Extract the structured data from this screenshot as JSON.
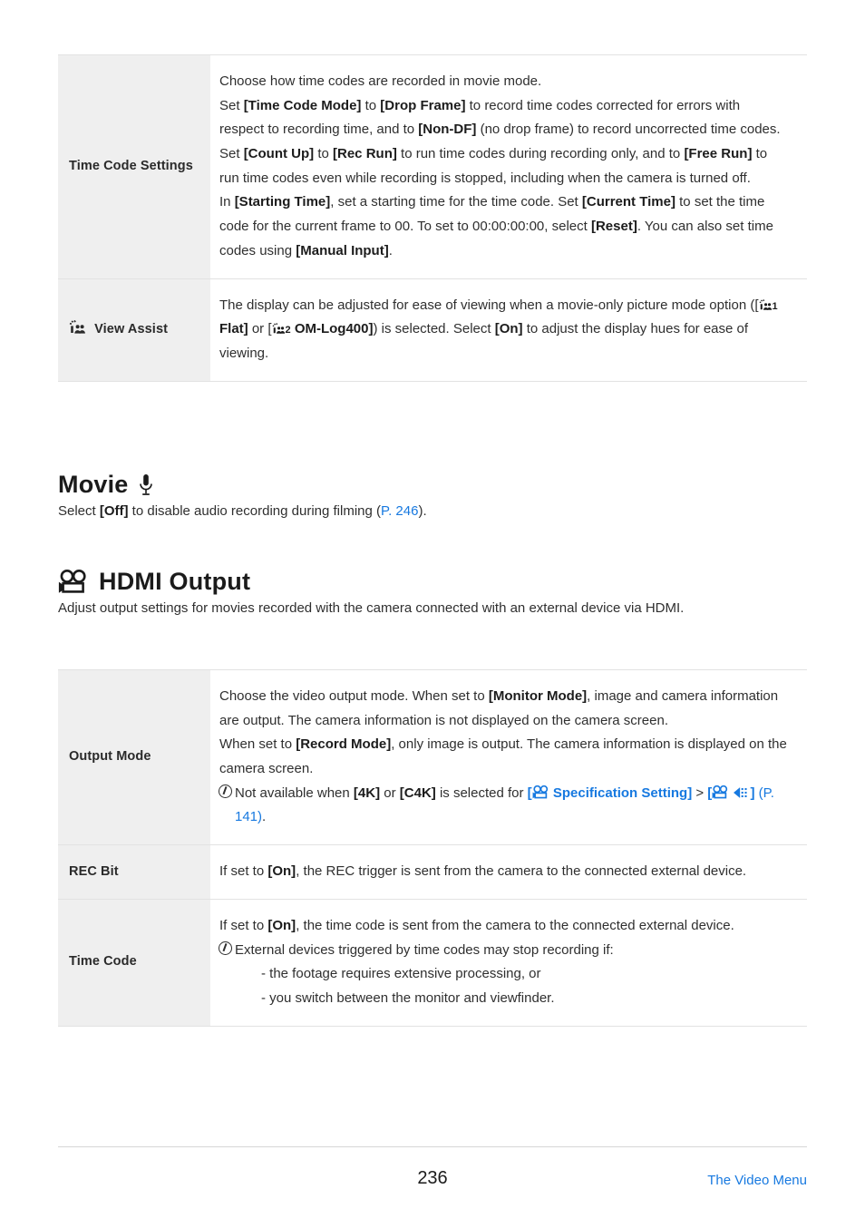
{
  "page": {
    "number": "236",
    "footer_link": "The Video Menu"
  },
  "table_timecode": {
    "rows": [
      {
        "label": "Time Code Settings",
        "label_icon": null,
        "paragraphs": [
          "Choose how time codes are recorded in movie mode.",
          "Set [Time Code Mode] to [Drop Frame] to record time codes corrected for errors with respect to recording time, and to [Non-DF] (no drop frame) to record uncorrected time codes.",
          "Set [Count Up] to [Rec Run] to run time codes during recording only, and to [Free Run] to run time codes even while recording is stopped, including when the camera is turned off.",
          "In [Starting Time], set a starting time for the time code. Set [Current Time] to set the time code for the current frame to 00. To set to 00:00:00:00, select [Reset]. You can also set time codes using [Manual Input]."
        ]
      },
      {
        "label": "View Assist",
        "label_icon": "picture-mode-movie-icon",
        "paragraphs": [
          "The display can be adjusted for ease of viewing when a movie-only picture mode option ([☀₁ Flat] or [☀₂ OM-Log400]) is selected. Select [On] to adjust the display hues for ease of viewing."
        ]
      }
    ]
  },
  "heading_movie": {
    "title": "Movie",
    "icon": "microphone-icon",
    "description_before": "Select ",
    "description_bold": "[Off]",
    "description_after": " to disable audio recording during filming (",
    "link": "P. 246",
    "description_end": ")."
  },
  "heading_hdmi": {
    "title": "HDMI Output",
    "icon": "movie-camera-icon",
    "description": "Adjust output settings for movies recorded with the camera connected with an external device via HDMI."
  },
  "table_hdmi": {
    "rows": [
      {
        "label": "Output Mode",
        "paragraphs": [
          "Choose the video output mode. When set to [Monitor Mode], image and camera information are output. The camera information is not displayed on the camera screen.",
          "When set to [Record Mode], only image is output. The camera information is displayed on the camera screen."
        ],
        "note": {
          "text_before": "Not available when ",
          "bold1": "[4K]",
          "mid1": " or ",
          "bold2": "[C4K]",
          "mid2": " is selected for ",
          "link_open": "[",
          "link_label": "Specification Setting]",
          "link_sep": " > ",
          "link2_open": "[",
          "link2_close": "]",
          "page_ref": "(P. 141)",
          "end": "."
        }
      },
      {
        "label": "REC Bit",
        "paragraphs": [
          "If set to [On], the REC trigger is sent from the camera to the connected external device."
        ]
      },
      {
        "label": "Time Code",
        "paragraphs": [
          "If set to [On], the time code is sent from the camera to the connected external device."
        ],
        "note_text": "External devices triggered by time codes may stop recording if:",
        "sub_items": [
          "- the footage requires extensive processing, or",
          "- you switch between the monitor and viewfinder."
        ]
      }
    ]
  },
  "colors": {
    "link": "#1779e0",
    "label_bg": "#efefef",
    "rule": "#e2e2e2",
    "text": "#2f2f2f"
  }
}
